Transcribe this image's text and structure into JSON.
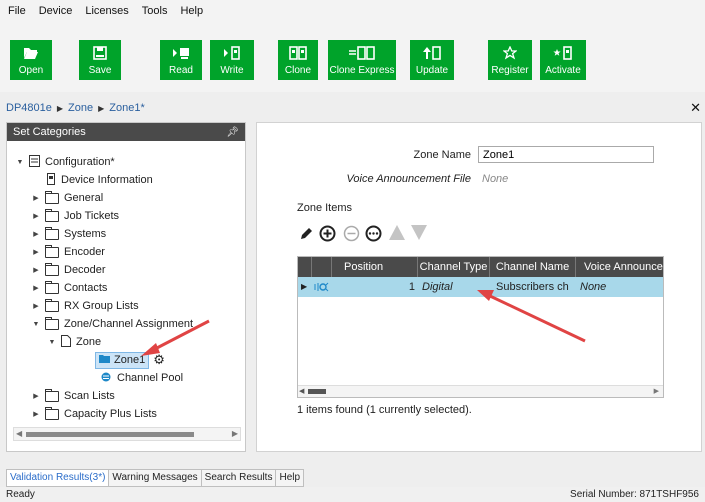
{
  "menu": [
    "File",
    "Device",
    "Licenses",
    "Tools",
    "Help"
  ],
  "toolbar": {
    "open": "Open",
    "save": "Save",
    "read": "Read",
    "write": "Write",
    "clone": "Clone",
    "clone_express": "Clone Express",
    "update": "Update",
    "register": "Register",
    "activate": "Activate"
  },
  "breadcrumb": [
    "DP4801e",
    "Zone",
    "Zone1*"
  ],
  "left_panel": {
    "title": "Set Categories",
    "tree": {
      "configuration": "Configuration*",
      "device_information": "Device Information",
      "general": "General",
      "job_tickets": "Job Tickets",
      "systems": "Systems",
      "encoder": "Encoder",
      "decoder": "Decoder",
      "contacts": "Contacts",
      "rx_group_lists": "RX Group Lists",
      "zone_channel_assignment": "Zone/Channel Assignment",
      "zone": "Zone",
      "zone1": "Zone1",
      "channel_pool": "Channel Pool",
      "scan_lists": "Scan Lists",
      "capacity_plus_lists": "Capacity Plus Lists"
    }
  },
  "form": {
    "zone_name_label": "Zone Name",
    "zone_name_value": "Zone1",
    "voice_announcement_label": "Voice Announcement File",
    "voice_announcement_value": "None",
    "zone_items_label": "Zone Items"
  },
  "grid": {
    "columns": [
      "Position",
      "Channel Type",
      "Channel Name",
      "Voice Announcem"
    ],
    "rows": [
      {
        "position": "1",
        "channel_type": "Digital",
        "channel_name": "Subscribers ch",
        "voice_announcement": "None"
      }
    ],
    "footer": "1 items found (1 currently selected)."
  },
  "bottom_tabs": [
    "Validation Results(3*)",
    "Warning Messages",
    "Search Results",
    "Help"
  ],
  "status": {
    "left": "Ready",
    "right": "Serial Number: 871TSHF956"
  },
  "colors": {
    "toolbar_green": "#00a32a",
    "header_dark": "#4a4a4a",
    "selection_blue": "#a8d8ea",
    "annotation_red": "#e04444"
  }
}
